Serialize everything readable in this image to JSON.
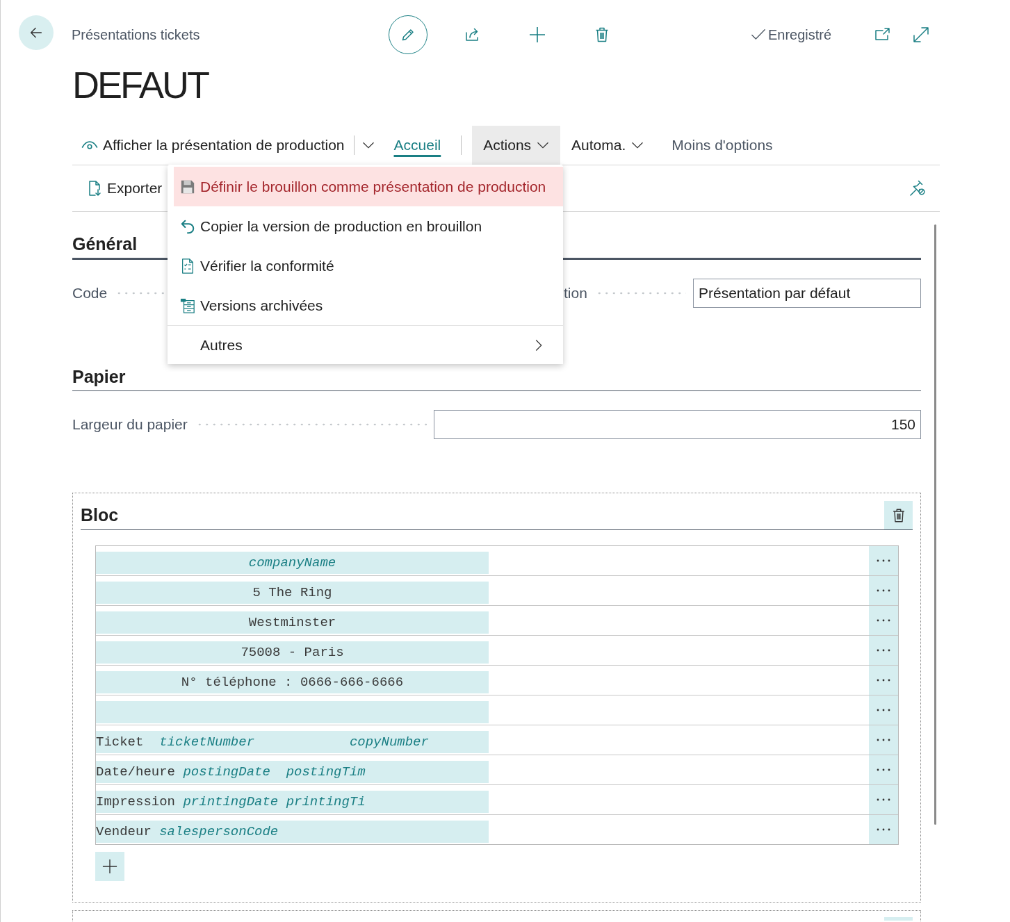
{
  "header": {
    "breadcrumb": "Présentations tickets",
    "status": "Enregistré"
  },
  "title": "DEFAUT",
  "action_bar": {
    "primary": "Afficher la présentation de production",
    "tabs": [
      {
        "label": "Accueil",
        "kind": "tab",
        "selected": true,
        "expanded": false
      },
      {
        "label": "Actions",
        "kind": "menu",
        "selected": false,
        "expanded": true
      },
      {
        "label": "Automa.",
        "kind": "menu",
        "selected": false,
        "expanded": false
      }
    ],
    "less_options": "Moins d'options"
  },
  "action_row": {
    "export": "Exporter"
  },
  "menu": {
    "items": [
      {
        "label": "Définir le brouillon comme présentation de production",
        "kind": "action",
        "highlighted": true
      },
      {
        "label": "Copier la version de production en brouillon",
        "kind": "action",
        "highlighted": false
      },
      {
        "label": "Vérifier la conformité",
        "kind": "action",
        "highlighted": false
      },
      {
        "label": "Versions archivées",
        "kind": "action",
        "highlighted": false
      },
      {
        "label": "Autres",
        "kind": "submenu",
        "highlighted": false
      }
    ]
  },
  "general": {
    "title": "Général",
    "fields": [
      {
        "label": "Code"
      },
      {
        "label": "tion",
        "value": "Présentation par défaut"
      }
    ]
  },
  "paper": {
    "title": "Papier",
    "fields": [
      {
        "label": "Largeur du papier",
        "value": "150"
      }
    ]
  },
  "bloc": {
    "title": "Bloc",
    "lines": [
      {
        "kind": "field",
        "centered": true,
        "text": "companyName"
      },
      {
        "kind": "literal",
        "centered": true,
        "text": "5 The Ring"
      },
      {
        "kind": "literal",
        "centered": true,
        "text": "Westminster"
      },
      {
        "kind": "literal",
        "centered": true,
        "text": "75008 - Paris"
      },
      {
        "kind": "literal",
        "centered": true,
        "text": "N° téléphone : 0666-666-6666"
      },
      {
        "kind": "blank"
      },
      {
        "kind": "literal",
        "centered": false,
        "text": "Ticket  *ticketNumber*            *copyNumber*"
      },
      {
        "kind": "literal",
        "centered": false,
        "text": "Date/heure *postingDate*  *postingTim*"
      },
      {
        "kind": "literal",
        "centered": false,
        "text": "Impression *printingDate* *printingTi*"
      },
      {
        "kind": "literal",
        "centered": false,
        "text": "Vendeur *salespersonCode*"
      }
    ]
  }
}
